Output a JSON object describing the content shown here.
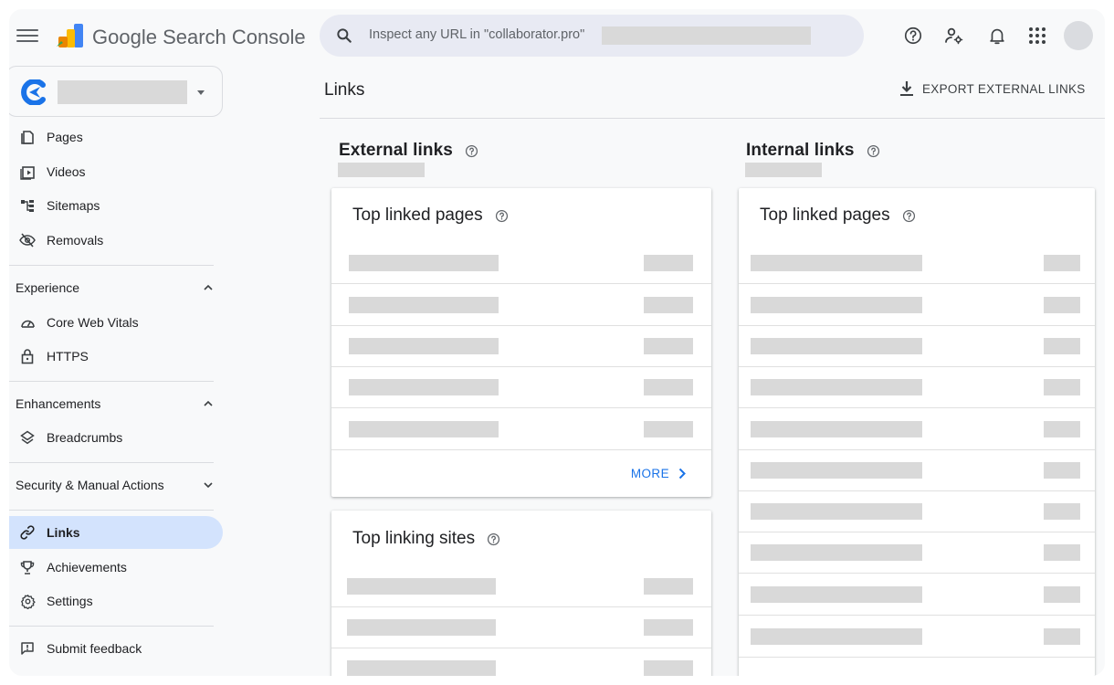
{
  "header": {
    "brand_google": "Google",
    "brand_product": "Search Console",
    "search_placeholder": "Inspect any URL in \"collaborator.pro\"",
    "icons": [
      "menu-icon",
      "search-icon",
      "help-icon",
      "manage-users-icon",
      "notifications-icon",
      "apps-icon"
    ]
  },
  "sidebar": {
    "top_items": [
      {
        "label": "Pages",
        "icon": "pages-icon"
      },
      {
        "label": "Videos",
        "icon": "videos-icon"
      },
      {
        "label": "Sitemaps",
        "icon": "sitemaps-icon"
      },
      {
        "label": "Removals",
        "icon": "removals-icon"
      }
    ],
    "experience": {
      "label": "Experience",
      "items": [
        {
          "label": "Core Web Vitals",
          "icon": "speed-icon"
        },
        {
          "label": "HTTPS",
          "icon": "lock-icon"
        }
      ]
    },
    "enhancements": {
      "label": "Enhancements",
      "items": [
        {
          "label": "Breadcrumbs",
          "icon": "layers-icon"
        }
      ]
    },
    "security": {
      "label": "Security & Manual Actions"
    },
    "bottom_items": [
      {
        "label": "Links",
        "icon": "link-icon",
        "active": true
      },
      {
        "label": "Achievements",
        "icon": "trophy-icon"
      },
      {
        "label": "Settings",
        "icon": "settings-icon"
      }
    ],
    "feedback": {
      "label": "Submit feedback",
      "icon": "feedback-icon"
    }
  },
  "main": {
    "title": "Links",
    "export_label": "EXPORT EXTERNAL LINKS",
    "external": {
      "title": "External links",
      "top_linked_pages": {
        "title": "Top linked pages",
        "more_label": "MORE"
      },
      "top_linking_sites": {
        "title": "Top linking sites"
      }
    },
    "internal": {
      "title": "Internal links",
      "top_linked_pages": {
        "title": "Top linked pages"
      }
    }
  },
  "colors": {
    "accent_blue": "#1a73e8",
    "active_nav_bg": "#d3e3fd",
    "redaction_gray": "#d9d9d9",
    "search_bg": "#e8eaf3"
  }
}
